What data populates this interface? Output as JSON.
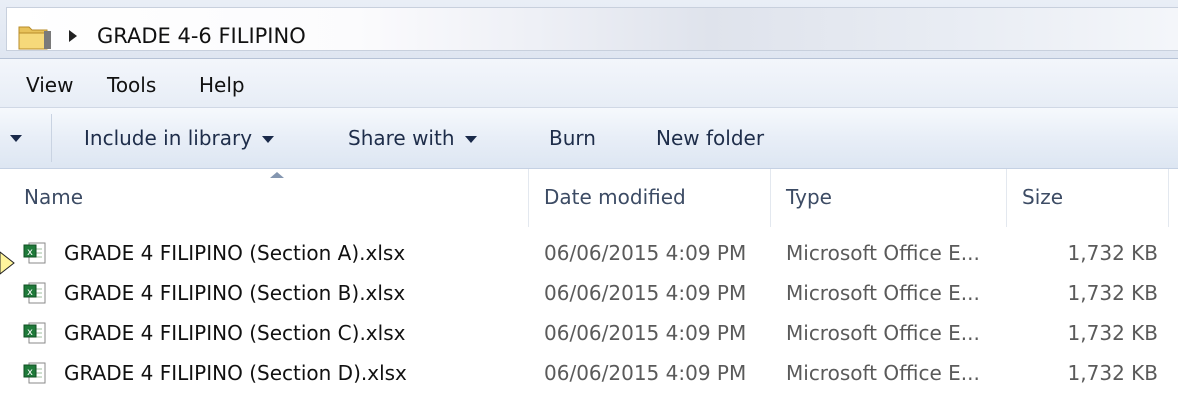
{
  "address": {
    "folder_icon": "folder-icon",
    "crumb": "GRADE 4-6 FILIPINO"
  },
  "menu": {
    "view": "View",
    "tools": "Tools",
    "help": "Help"
  },
  "toolbar": {
    "include": "Include in library",
    "share": "Share with",
    "burn": "Burn",
    "new_folder": "New folder"
  },
  "columns": {
    "name": "Name",
    "date": "Date modified",
    "type": "Type",
    "size": "Size"
  },
  "files": [
    {
      "name": "GRADE 4 FILIPINO (Section A).xlsx",
      "date": "06/06/2015 4:09 PM",
      "type": "Microsoft Office E...",
      "size": "1,732 KB"
    },
    {
      "name": "GRADE 4 FILIPINO (Section B).xlsx",
      "date": "06/06/2015 4:09 PM",
      "type": "Microsoft Office E...",
      "size": "1,732 KB"
    },
    {
      "name": "GRADE 4 FILIPINO (Section C).xlsx",
      "date": "06/06/2015 4:09 PM",
      "type": "Microsoft Office E...",
      "size": "1,732 KB"
    },
    {
      "name": "GRADE 4 FILIPINO (Section D).xlsx",
      "date": "06/06/2015 4:09 PM",
      "type": "Microsoft Office E...",
      "size": "1,732 KB"
    }
  ],
  "colors": {
    "excel_green": "#1f7a3a",
    "pointer_yellow": "#fff59d"
  }
}
